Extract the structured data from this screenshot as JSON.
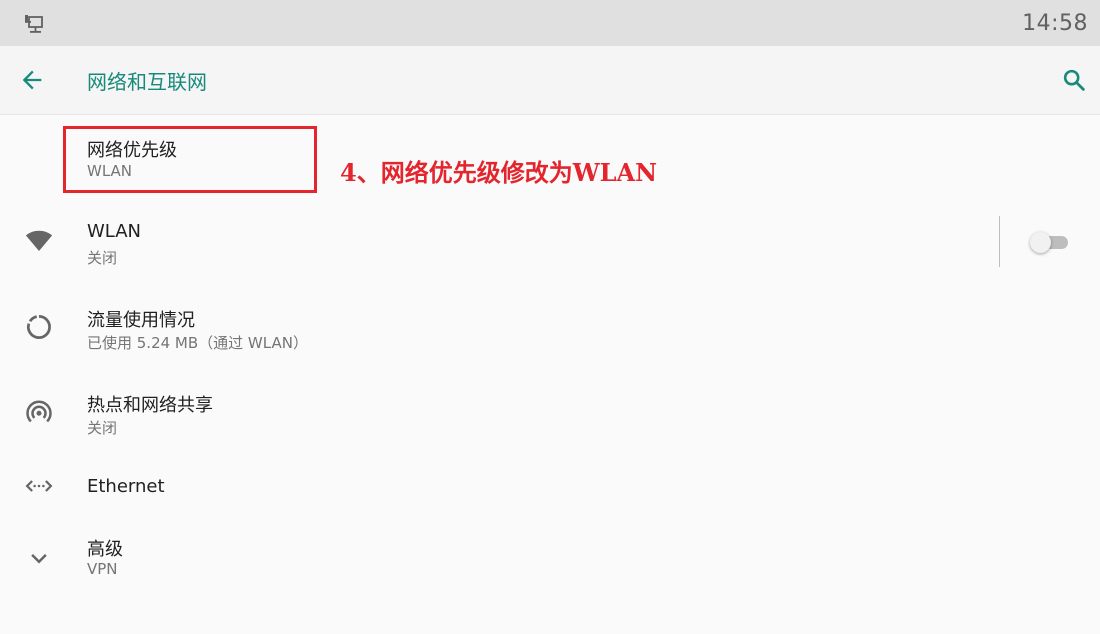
{
  "status_bar": {
    "time": "14:58",
    "icon": "network-monitor-icon"
  },
  "app_bar": {
    "title": "网络和互联网",
    "back_icon": "arrow-left-icon",
    "search_icon": "search-icon",
    "accent_color": "#188a7b"
  },
  "annotation": {
    "text": "4、网络优先级修改为WLAN",
    "color": "#e3262e"
  },
  "items": [
    {
      "title": "网络优先级",
      "subtitle": "WLAN",
      "icon": ""
    },
    {
      "title": "WLAN",
      "subtitle": "关闭",
      "icon": "wifi-icon",
      "toggle_on": false
    },
    {
      "title": "流量使用情况",
      "subtitle": "已使用 5.24 MB（通过 WLAN）",
      "icon": "data-usage-icon"
    },
    {
      "title": "热点和网络共享",
      "subtitle": "关闭",
      "icon": "hotspot-icon"
    },
    {
      "title": "Ethernet",
      "subtitle": "",
      "icon": "ethernet-icon"
    },
    {
      "title": "高级",
      "subtitle": "VPN",
      "icon": "chevron-down-icon"
    }
  ]
}
